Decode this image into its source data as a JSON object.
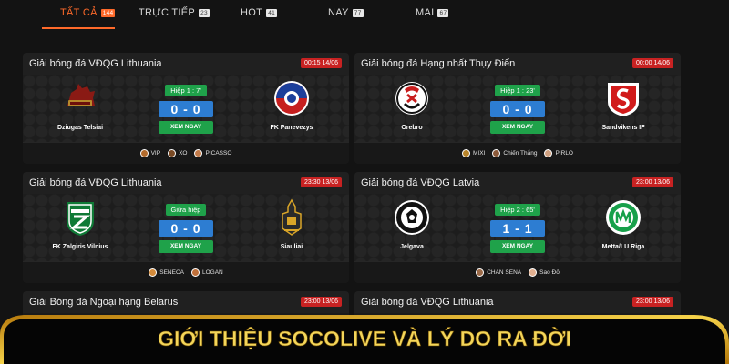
{
  "tabs": [
    {
      "label": "TẤT CẢ",
      "count": "144"
    },
    {
      "label": "TRỰC TIẾP",
      "count": "23"
    },
    {
      "label": "HOT",
      "count": "41"
    },
    {
      "label": "NAY",
      "count": "77"
    },
    {
      "label": "MAI",
      "count": "67"
    }
  ],
  "matches": [
    {
      "league": "Giải bóng đá VĐQG Lithuania",
      "date": "00:15 14/06",
      "status": "Hiệp 1 : 7'",
      "score": "0 - 0",
      "watch": "XEM NGAY",
      "home": {
        "name": "Dziugas Telsiai",
        "logo": "dziugas-logo"
      },
      "away": {
        "name": "FK Panevezys",
        "logo": "panevezys-logo"
      },
      "casters": [
        {
          "name": "VIP"
        },
        {
          "name": "XO"
        },
        {
          "name": "PICASSO"
        }
      ]
    },
    {
      "league": "Giải bóng đá Hạng nhất Thụy Điển",
      "date": "00:00 14/06",
      "status": "Hiệp 1 : 23'",
      "score": "0 - 0",
      "watch": "XEM NGAY",
      "home": {
        "name": "Orebro",
        "logo": "orebro-logo"
      },
      "away": {
        "name": "Sandvikens IF",
        "logo": "sandvikens-logo"
      },
      "casters": [
        {
          "name": "MIXI"
        },
        {
          "name": "Chiến Thắng"
        },
        {
          "name": "PIRLO"
        }
      ]
    },
    {
      "league": "Giải bóng đá VĐQG Lithuania",
      "date": "23:30 13/06",
      "status": "Giữa hiệp",
      "score": "0 - 0",
      "watch": "XEM NGAY",
      "home": {
        "name": "FK Zalgiris Vilnius",
        "logo": "zalgiris-logo"
      },
      "away": {
        "name": "Siauliai",
        "logo": "siauliai-logo"
      },
      "casters": [
        {
          "name": "SENECA"
        },
        {
          "name": "LOGAN"
        }
      ]
    },
    {
      "league": "Giải bóng đá VĐQG Latvia",
      "date": "23:00 13/06",
      "status": "Hiệp 2 : 65'",
      "score": "1 - 1",
      "watch": "XEM NGAY",
      "home": {
        "name": "Jelgava",
        "logo": "jelgava-logo"
      },
      "away": {
        "name": "Metta/LU Riga",
        "logo": "metta-logo"
      },
      "casters": [
        {
          "name": "CHAN SENA"
        },
        {
          "name": "Sao Đỏ"
        }
      ]
    },
    {
      "league": "Giải Bóng đá Ngoại hạng Belarus",
      "date": "23:00 13/06"
    },
    {
      "league": "Giải bóng đá VĐQG Lithuania",
      "date": "23:00 13/06"
    }
  ],
  "banner": {
    "title": "GIỚI THIỆU SOCOLIVE VÀ LÝ DO RA ĐỜI"
  },
  "colors": {
    "accent": "#ff6a2a",
    "live_red": "#c82222",
    "status_green": "#1fa24a",
    "score_blue": "#2d7dd2",
    "banner_gold": "#f2c21a"
  }
}
